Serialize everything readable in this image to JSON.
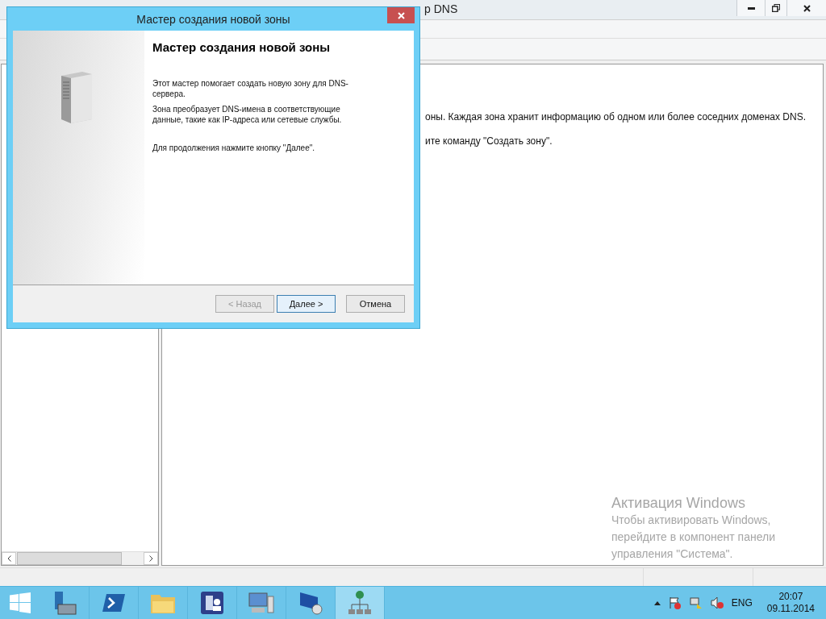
{
  "main_window": {
    "title": "р DNS",
    "content_lines": [
      "оны. Каждая зона хранит информацию об одном или более соседних доменах DNS.",
      "ите команду \"Создать зону\"."
    ]
  },
  "dialog": {
    "title": "Мастер создания новой зоны",
    "heading": "Мастер создания новой зоны",
    "paragraphs": [
      "Этот мастер помогает создать новую зону для DNS-сервера.",
      "Зона преобразует DNS-имена в соответствующие данные, такие как IP-адреса или сетевые службы.",
      "Для продолжения нажмите кнопку \"Далее\"."
    ],
    "buttons": [
      {
        "label": "< Назад",
        "disabled": true,
        "default": false
      },
      {
        "label": "Далее >",
        "disabled": false,
        "default": true
      },
      {
        "label": "Отмена",
        "disabled": false,
        "default": false
      }
    ]
  },
  "activation": {
    "title": "Активация Windows",
    "text": "Чтобы активировать Windows, перейдите в компонент панели управления \"Система\"."
  },
  "taskbar": {
    "apps": [
      {
        "kind": "server",
        "selected": false
      },
      {
        "kind": "shell",
        "selected": false
      },
      {
        "kind": "folder",
        "selected": false
      },
      {
        "kind": "directory",
        "selected": false
      },
      {
        "kind": "computer",
        "selected": false
      },
      {
        "kind": "remote",
        "selected": false
      },
      {
        "kind": "network",
        "selected": true
      }
    ],
    "language": "ENG",
    "time": "20:07",
    "date": "09.11.2014"
  }
}
